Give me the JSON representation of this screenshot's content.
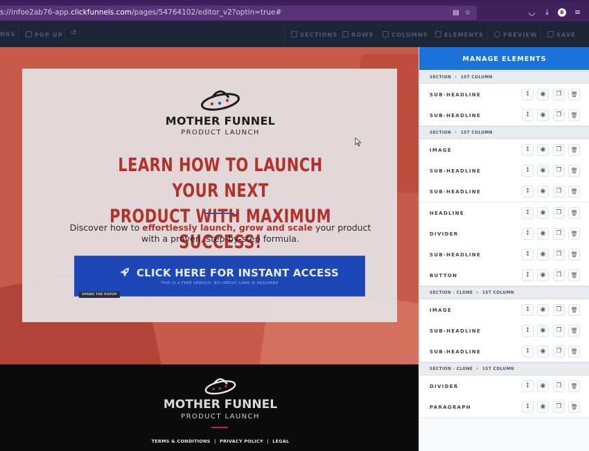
{
  "browser": {
    "url_prefix": "s://infoe2ab76-app.",
    "url_domain": "clickfunnels.com",
    "url_path": "/pages/54764102/editor_v2?optin=true#",
    "avatar_letter": "B",
    "icons": [
      "reader-view-icon",
      "bookmark-star-icon",
      "pocket-icon",
      "download-icon",
      "account-icon",
      "menu-icon"
    ]
  },
  "toolbar": {
    "settings_partial": "NGS",
    "popup": "POP UP",
    "sections": "SECTIONS",
    "rows": "ROWS",
    "columns": "COLUMNS",
    "elements": "ELEMENTS",
    "preview": "PREVIEW",
    "save": "SAVE"
  },
  "hero": {
    "brand_title": "MOTHER FUNNEL",
    "brand_sub": "PRODUCT LAUNCH",
    "headline_line1": "LEARN HOW TO LAUNCH YOUR NEXT",
    "headline_line2": "PRODUCT WITH MAXIMUM SUCCESS!",
    "para_a": "Discover how to ",
    "para_em": "effortlessly launch, grow and scale",
    "para_b": " your product",
    "para_c": "with a proven, step-by-step formula.",
    "cta_main": "CLICK HERE FOR INSTANT ACCESS",
    "cta_sub": "THIS IS A FREE SERVICE, NO CREDIT CARD IS REQUIRED",
    "popup_tag": "OPENS THE POPUP"
  },
  "footer": {
    "brand_title": "MOTHER FUNNEL",
    "brand_sub": "PRODUCT LAUNCH",
    "link_terms": "TERMS & CONDITIONS",
    "link_privacy": "PRIVACY POLICY",
    "link_legal": "LEGAL",
    "sep": "|"
  },
  "panel": {
    "title": "MANAGE ELEMENTS",
    "groups": [
      {
        "section": "SECTION",
        "column": "1ST COLUMN",
        "items": [
          "SUB-HEADLINE",
          "SUB-HEADLINE"
        ]
      },
      {
        "section": "SECTION",
        "column": "1ST COLUMN",
        "items": [
          "IMAGE",
          "SUB-HEADLINE",
          "SUB-HEADLINE",
          "HEADLINE",
          "DIVIDER",
          "SUB-HEADLINE",
          "BUTTON"
        ]
      },
      {
        "section": "SECTION - CLONE",
        "column": "1ST COLUMN",
        "items": [
          "IMAGE",
          "SUB-HEADLINE",
          "SUB-HEADLINE"
        ]
      },
      {
        "section": "SECTION - CLONE",
        "column": "1ST COLUMN",
        "items": [
          "DIVIDER",
          "PARAGRAPH"
        ]
      }
    ],
    "row_actions": [
      "move-icon",
      "eye-icon",
      "copy-icon",
      "trash-icon"
    ]
  },
  "colors": {
    "browser": "#43215f",
    "toolbar": "#1d2636",
    "hero_bg": "#c85a4a",
    "headline": "#b3312a",
    "cta": "#1d47b6",
    "panel_header": "#1a73d9",
    "footer_bg": "#0b0b0b"
  }
}
